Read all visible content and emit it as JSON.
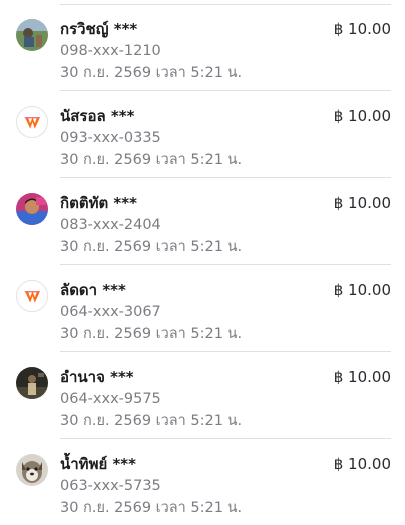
{
  "transactions": [
    {
      "name": "กรวิชญ์ ***",
      "phone": "098-xxx-1210",
      "timestamp": "30 ก.ย. 2569 เวลา 5:21 น.",
      "amount": "฿ 10.00",
      "avatar": "photo-avatar-field"
    },
    {
      "name": "นัสรอล ***",
      "phone": "093-xxx-0335",
      "timestamp": "30 ก.ย. 2569 เวลา 5:21 น.",
      "amount": "฿ 10.00",
      "avatar": "wallet-brand-icon"
    },
    {
      "name": "กิตติทัต ***",
      "phone": "083-xxx-2404",
      "timestamp": "30 ก.ย. 2569 เวลา 5:21 น.",
      "amount": "฿ 10.00",
      "avatar": "photo-avatar-portrait"
    },
    {
      "name": "ลัดดา ***",
      "phone": "064-xxx-3067",
      "timestamp": "30 ก.ย. 2569 เวลา 5:21 น.",
      "amount": "฿ 10.00",
      "avatar": "wallet-brand-icon"
    },
    {
      "name": "อำนาจ ***",
      "phone": "064-xxx-9575",
      "timestamp": "30 ก.ย. 2569 เวลา 5:21 น.",
      "amount": "฿ 10.00",
      "avatar": "photo-avatar-dark"
    },
    {
      "name": "น้ำทิพย์ ***",
      "phone": "063-xxx-5735",
      "timestamp": "30 ก.ย. 2569 เวลา 5:21 น.",
      "amount": "฿ 10.00",
      "avatar": "photo-avatar-dog"
    }
  ],
  "colors": {
    "brand_orange": "#ff6a13",
    "brand_red": "#e8212b",
    "text_primary": "#1c1c1f",
    "text_secondary": "#7c7c84",
    "divider": "#e0e0e3"
  }
}
